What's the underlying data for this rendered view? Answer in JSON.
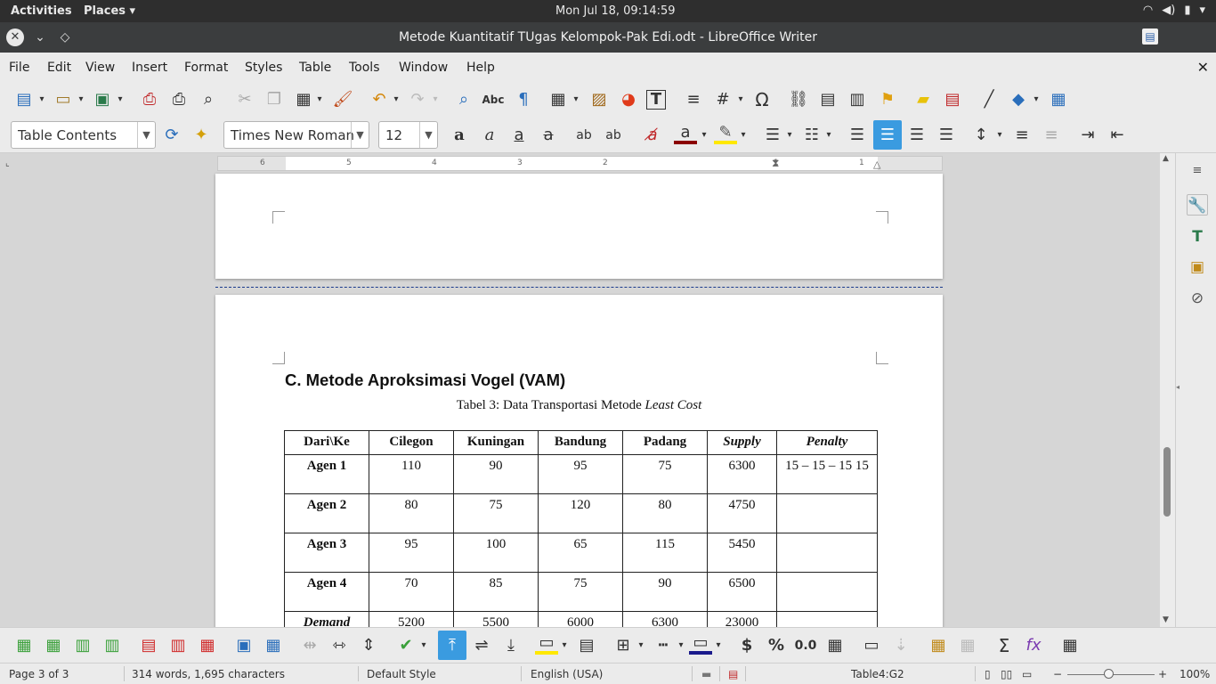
{
  "system": {
    "activities": "Activities",
    "places": "Places",
    "clock": "Mon Jul 18, 09:14:59"
  },
  "window": {
    "title": "Metode Kuantitatif TUgas Kelompok-Pak Edi.odt - LibreOffice Writer"
  },
  "menu": [
    "File",
    "Edit",
    "View",
    "Insert",
    "Format",
    "Styles",
    "Table",
    "Tools",
    "Window",
    "Help"
  ],
  "formatting": {
    "paragraph_style": "Table Contents",
    "font_name": "Times New Roman",
    "font_size": "12",
    "alignment": "center",
    "font_color": "#8b0000",
    "highlight_color": "#ffe800"
  },
  "ruler": {
    "numbers": [
      "6",
      "5",
      "4",
      "3",
      "2",
      "1",
      "1"
    ]
  },
  "document": {
    "heading": "C. Metode Aproksimasi Vogel (VAM)",
    "caption_prefix": "Tabel 3: Data Transportasi Metode ",
    "caption_italic": "Least Cost",
    "table": {
      "headers": [
        "Dari\\Ke",
        "Cilegon",
        "Kuningan",
        "Bandung",
        "Padang",
        "Supply",
        "Penalty"
      ],
      "rows": [
        [
          "Agen 1",
          "110",
          "90",
          "95",
          "75",
          "6300",
          "15 – 15 – 15 15"
        ],
        [
          "Agen 2",
          "80",
          "75",
          "120",
          "80",
          "4750",
          ""
        ],
        [
          "Agen 3",
          "95",
          "100",
          "65",
          "115",
          "5450",
          ""
        ],
        [
          "Agen 4",
          "70",
          "85",
          "75",
          "90",
          "6500",
          ""
        ],
        [
          "Demand",
          "5200",
          "5500",
          "6000",
          "6300",
          "23000",
          ""
        ]
      ]
    }
  },
  "status": {
    "page": "Page 3 of 3",
    "words": "314 words, 1,695 characters",
    "page_style": "Default Style",
    "language": "English (USA)",
    "cell": "Table4:G2",
    "zoom": "100%"
  }
}
